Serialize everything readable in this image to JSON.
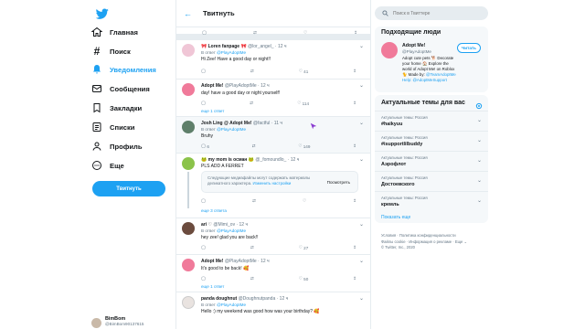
{
  "nav": {
    "items": [
      {
        "label": "Главная",
        "icon": "home-icon"
      },
      {
        "label": "Поиск",
        "icon": "hashtag-icon"
      },
      {
        "label": "Уведомления",
        "icon": "bell-icon"
      },
      {
        "label": "Сообщения",
        "icon": "mail-icon"
      },
      {
        "label": "Закладки",
        "icon": "bookmark-icon"
      },
      {
        "label": "Списки",
        "icon": "list-icon"
      },
      {
        "label": "Профиль",
        "icon": "profile-icon"
      },
      {
        "label": "Еще",
        "icon": "more-icon"
      }
    ],
    "tweet_button": "Твитнуть",
    "account": {
      "name": "BimBom",
      "handle": "@BimBom90137615"
    }
  },
  "main": {
    "title": "Твитнуть",
    "tweets": [
      {
        "name": "🎀 Loren fanpage 🎀",
        "meta": "@lor_angel_ · 12 ч",
        "reply_prefix": "В ответ",
        "reply_to": "@PlayAdoptMe",
        "text": "Hi Zee! Have a good day or night!!",
        "replies": "",
        "likes": "41"
      },
      {
        "name": "Adopt Me!",
        "meta": "@PlayAdoptMe · 12 ч",
        "reply_prefix": "",
        "reply_to": "",
        "text": "day! have a good day or night yourself!",
        "replies": "",
        "likes": "114",
        "more": "еще 1 ответ"
      },
      {
        "name": "Josh Ling @ Adopt Me!",
        "meta": "@factful · 11 ч",
        "reply_prefix": "В ответ",
        "reply_to": "@PlayAdoptMe",
        "text": "Bruhy",
        "replies": "6",
        "likes": "149"
      },
      {
        "name": "🐸 my mom is осман 🐸",
        "meta": "@_fomoundlo_ · 12 ч",
        "reply_prefix": "",
        "reply_to": "",
        "text": "PLS ADD A FERRET",
        "warning": "Следующие медиафайлы могут содержать материалы деликатного характера.",
        "warning_link": "Изменить настройки",
        "warning_button": "Посмотреть",
        "more": "еще 3 ответа"
      },
      {
        "name": "ari ♡",
        "meta": "@Mimi_ov · 12 ч",
        "reply_prefix": "В ответ",
        "reply_to": "@PlayAdoptMe",
        "text": "hey zee! glad you are back!!",
        "replies": "",
        "likes": "27"
      },
      {
        "name": "Adopt Me!",
        "meta": "@PlayAdoptMe · 12 ч",
        "reply_prefix": "",
        "reply_to": "",
        "text": "It's good to be back! 🥰",
        "replies": "",
        "likes": "50",
        "more": "еще 1 ответ"
      },
      {
        "name": "panda doughnut",
        "meta": "@Doughnutpanda · 12 ч",
        "reply_prefix": "В ответ",
        "reply_to": "@PlayAdoptMe",
        "text": "Hello :) my weekend was good how was your birthday? 🥰",
        "replies": "",
        "likes": ""
      }
    ]
  },
  "search": {
    "placeholder": "Поиск в Твиттере"
  },
  "who_to_follow": {
    "title": "Подходящие люди",
    "name": "Adopt Me!",
    "handle": "@PlayAdoptMe",
    "bio": "Adopt cute pets 🐕 Decorate your home 🏠 Explore the world of Adopt Me! on Roblox 🐈 Made by:",
    "bio_links": "@TeamAdoptMe Help: @AdoptMeSupport",
    "button": "Читать"
  },
  "trends": {
    "title": "Актуальные темы для вас",
    "items": [
      {
        "context": "Актуальные темы: Россия",
        "name": "#haikyuu"
      },
      {
        "context": "Актуальные темы: Россия",
        "name": "#isupportlilbuddy"
      },
      {
        "context": "Актуальные темы: Россия",
        "name": "Аэрофлот"
      },
      {
        "context": "Актуальные темы: Россия",
        "name": "Достоевского"
      },
      {
        "context": "Актуальные темы: Россия",
        "name": "кремль"
      }
    ],
    "show_more": "Показать еще"
  },
  "footer": {
    "line1": "Условия · Политика конфиденциальности",
    "line2": "Файлы cookie · Информация о рекламе · Еще ⌄",
    "line3": "© Twitter, Inc., 2020"
  },
  "colors": {
    "accent": "#1da1f2"
  }
}
